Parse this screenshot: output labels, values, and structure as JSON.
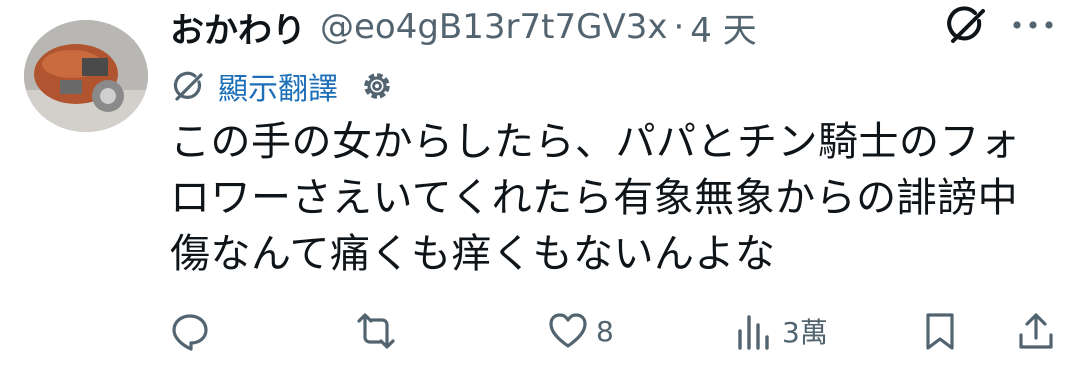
{
  "tweet": {
    "display_name": "おかわり",
    "handle": "@eo4gB13r7t7GV3x",
    "separator": "·",
    "time": "4 天",
    "translate_label": "顯示翻譯",
    "text": "この手の女からしたら、パパとチン騎士のフォ\nロワーさえいてくれたら有象無象からの誹謗中\n傷なんて痛くも痒くもないんよな"
  },
  "actions": {
    "reply_count": "",
    "retweet_count": "",
    "like_count": "8",
    "view_count": "3萬"
  },
  "colors": {
    "text": "#0f1419",
    "secondary": "#536471",
    "translate_link": "#1d6fb8"
  },
  "icons": [
    "avatar",
    "grok-icon",
    "more-icon",
    "translate-icon",
    "settings-gear-icon",
    "reply-icon",
    "retweet-icon",
    "like-icon",
    "views-icon",
    "bookmark-icon",
    "share-icon"
  ]
}
